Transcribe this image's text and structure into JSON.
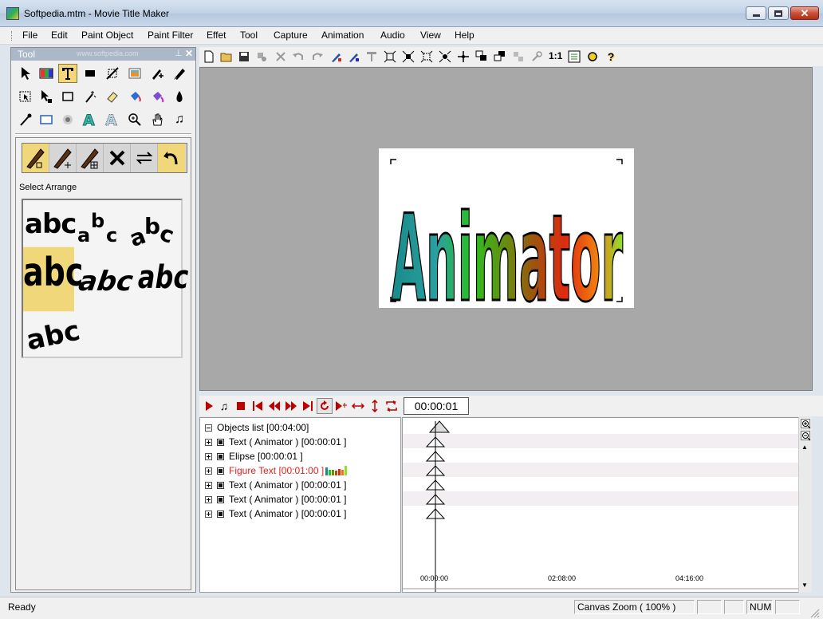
{
  "window": {
    "title": "Softpedia.mtm - Movie Title Maker"
  },
  "menu": [
    "File",
    "Edit",
    "Paint Object",
    "Paint Filter",
    "Effet",
    "Tool",
    "Capture",
    "Animation",
    "Audio",
    "View",
    "Help"
  ],
  "tool_panel": {
    "title": "Tool",
    "watermark": "www.softpedia.com",
    "select_arrange_label": "Select Arrange",
    "arrange_samples": [
      "abc",
      "abc",
      "abc",
      "abc",
      "abc",
      "abc",
      "abc"
    ]
  },
  "toolbar": {
    "zoom_label": "1:1"
  },
  "canvas": {
    "text": "Animator"
  },
  "timeline": {
    "time_value": "00:00:01",
    "objects_list_label": "Objects list [00:04:00]",
    "rows": [
      {
        "label": "Text ( Animator ) [00:00:01 ]",
        "red": false
      },
      {
        "label": "Elipse [00:00:01 ]",
        "red": false
      },
      {
        "label": "Figure Text [00:01:00 ]",
        "red": true
      },
      {
        "label": "Text ( Animator ) [00:00:01 ]",
        "red": false
      },
      {
        "label": "Text ( Animator ) [00:00:01 ]",
        "red": false
      },
      {
        "label": "Text ( Animator ) [00:00:01 ]",
        "red": false
      }
    ],
    "ruler_labels": [
      "00:00:00",
      "02:08:00",
      "04:16:00"
    ]
  },
  "status": {
    "text": "Ready",
    "zoom": "Canvas Zoom ( 100% )",
    "num": "NUM"
  },
  "colors": {
    "active_tool": "#f3d77a",
    "canvas_bg": "#a8a8a8",
    "figure_text_red": "#e0201c"
  }
}
